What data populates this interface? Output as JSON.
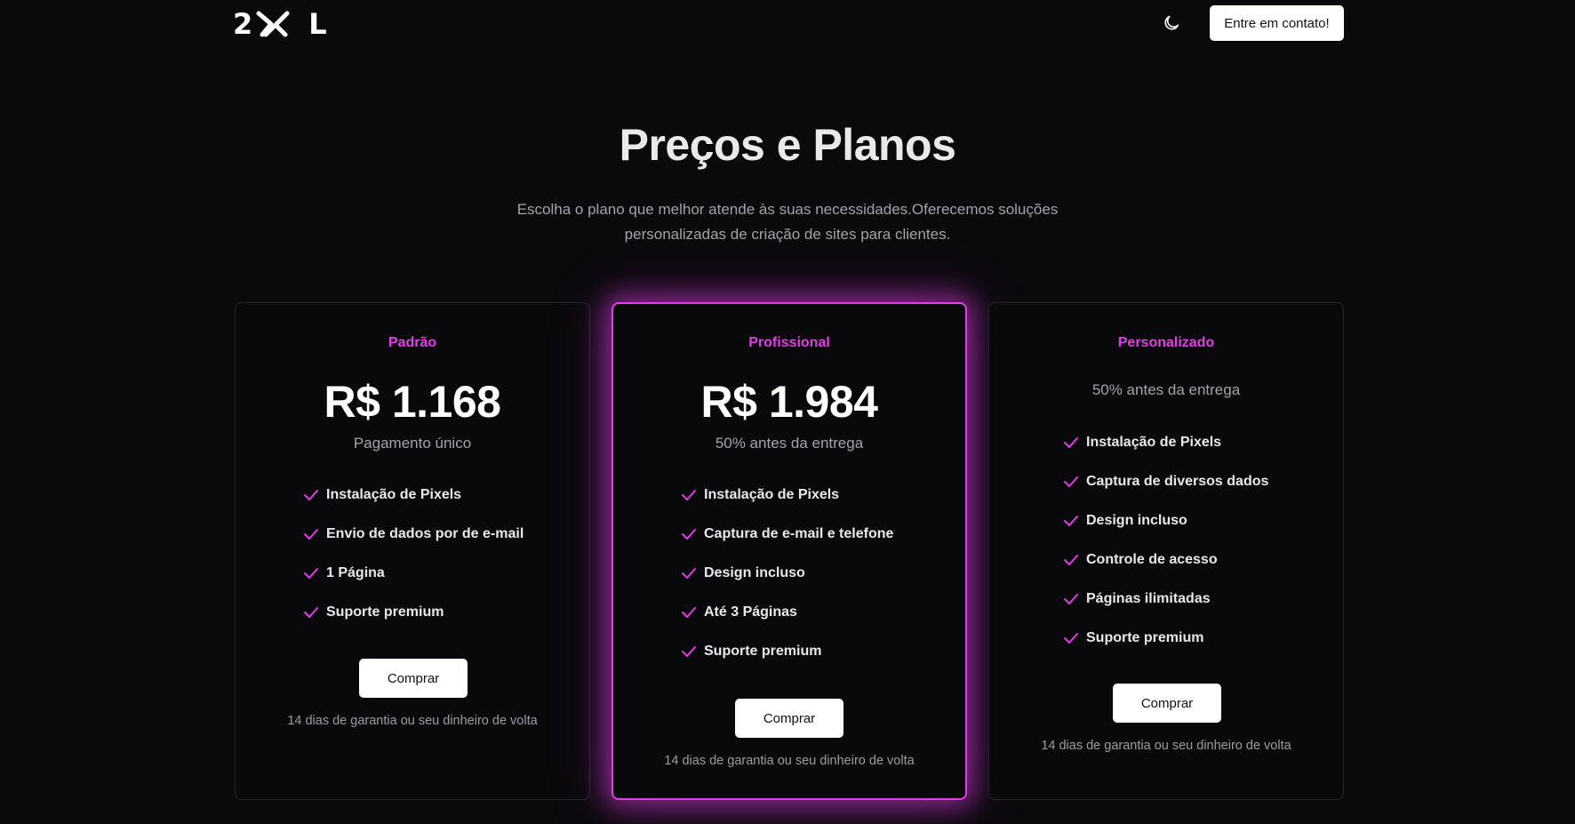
{
  "header": {
    "logo": {
      "left": "2",
      "right": "L"
    },
    "theme_toggle_icon": "moon-icon",
    "contact_label": "Entre em contato!"
  },
  "hero": {
    "title": "Preços e Planos",
    "subtitle": "Escolha o plano que melhor atende às suas necessidades.Oferecemos soluções personalizadas de criação de sites para clientes."
  },
  "colors": {
    "accent": "#e23ee6",
    "background": "#0a0a0c",
    "button_bg": "#ffffff"
  },
  "plans": [
    {
      "name": "Padrão",
      "price": "R$ 1.168",
      "note": "Pagamento único",
      "features": [
        "Instalação de Pixels",
        "Envio de dados por de e-mail",
        "1 Página",
        "Suporte premium"
      ],
      "button": "Comprar",
      "guarantee": "14 dias de garantia ou seu dinheiro de volta"
    },
    {
      "name": "Profissional",
      "price": "R$ 1.984",
      "note": "50% antes da entrega",
      "features": [
        "Instalação de Pixels",
        "Captura de e-mail e telefone",
        "Design incluso",
        "Até 3 Páginas",
        "Suporte premium"
      ],
      "button": "Comprar",
      "guarantee": "14 dias de garantia ou seu dinheiro de volta",
      "featured": true
    },
    {
      "name": "Personalizado",
      "note": "50% antes da entrega",
      "features": [
        "Instalação de Pixels",
        "Captura de diversos dados",
        "Design incluso",
        "Controle de acesso",
        "Páginas ilimitadas",
        "Suporte premium"
      ],
      "button": "Comprar",
      "guarantee": "14 dias de garantia ou seu dinheiro de volta"
    }
  ]
}
